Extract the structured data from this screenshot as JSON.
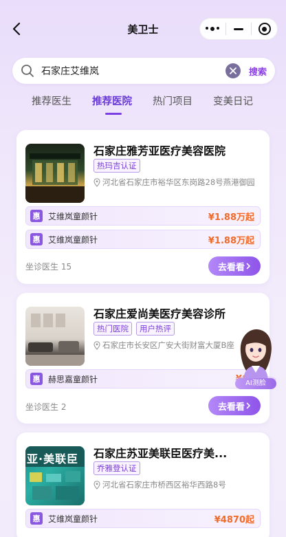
{
  "header": {
    "title": "美卫士"
  },
  "search": {
    "value": "石家庄艾维岚",
    "button_label": "搜索"
  },
  "tabs": [
    {
      "label": "推荐医生",
      "active": false
    },
    {
      "label": "推荐医院",
      "active": true
    },
    {
      "label": "热门项目",
      "active": false
    },
    {
      "label": "变美日记",
      "active": false
    }
  ],
  "hospitals": [
    {
      "name": "石家庄雅芳亚医疗美容医院",
      "tags": [
        "热玛吉认证"
      ],
      "address": "河北省石家庄市裕华区东岗路28号燕港御园",
      "projects": [
        {
          "badge": "惠",
          "name": "艾维岚童颜针",
          "price": "¥1.88万起"
        },
        {
          "badge": "惠",
          "name": "艾维岚童颜针",
          "price": "¥1.88万起"
        }
      ],
      "doctors": "坐诊医生 15",
      "button": "去看看"
    },
    {
      "name": "石家庄爱尚美医疗美容诊所",
      "tags": [
        "热门医院",
        "用户热评"
      ],
      "address": "石家庄市长安区广安大街财富大厦B座",
      "projects": [
        {
          "badge": "惠",
          "name": "赫思嘉童颜针",
          "price": "¥64"
        }
      ],
      "doctors": "坐诊医生 2",
      "button": "去看看"
    },
    {
      "name": "石家庄苏亚美联臣医疗美...",
      "tags": [
        "乔雅登认证"
      ],
      "address": "河北省石家庄市桥西区裕华西路8号",
      "projects": [
        {
          "badge": "惠",
          "name": "艾维岚童颜针",
          "price": "¥4870起"
        }
      ],
      "thumb_sign": "亚·美联臣"
    }
  ],
  "ai_assistant": {
    "label": "AI测脸"
  },
  "colors": {
    "accent": "#7b3fe4",
    "price": "#f06a2a",
    "tag": "#7a3fd8"
  },
  "icons": [
    "back-icon",
    "more-icon",
    "minimize-icon",
    "close-target-icon",
    "search-icon",
    "clear-icon",
    "location-pin-icon",
    "chevron-right-icon"
  ]
}
